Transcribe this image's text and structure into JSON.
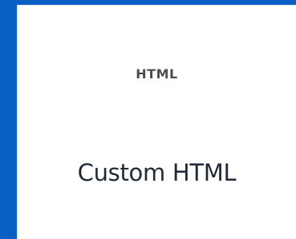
{
  "tile": {
    "icon_text": "HTML",
    "label": "Custom HTML"
  },
  "colors": {
    "frame": "#0a5fc2",
    "tile_background": "#ffffff",
    "icon_text": "#4d4d4d",
    "label": "#1f2a36"
  }
}
